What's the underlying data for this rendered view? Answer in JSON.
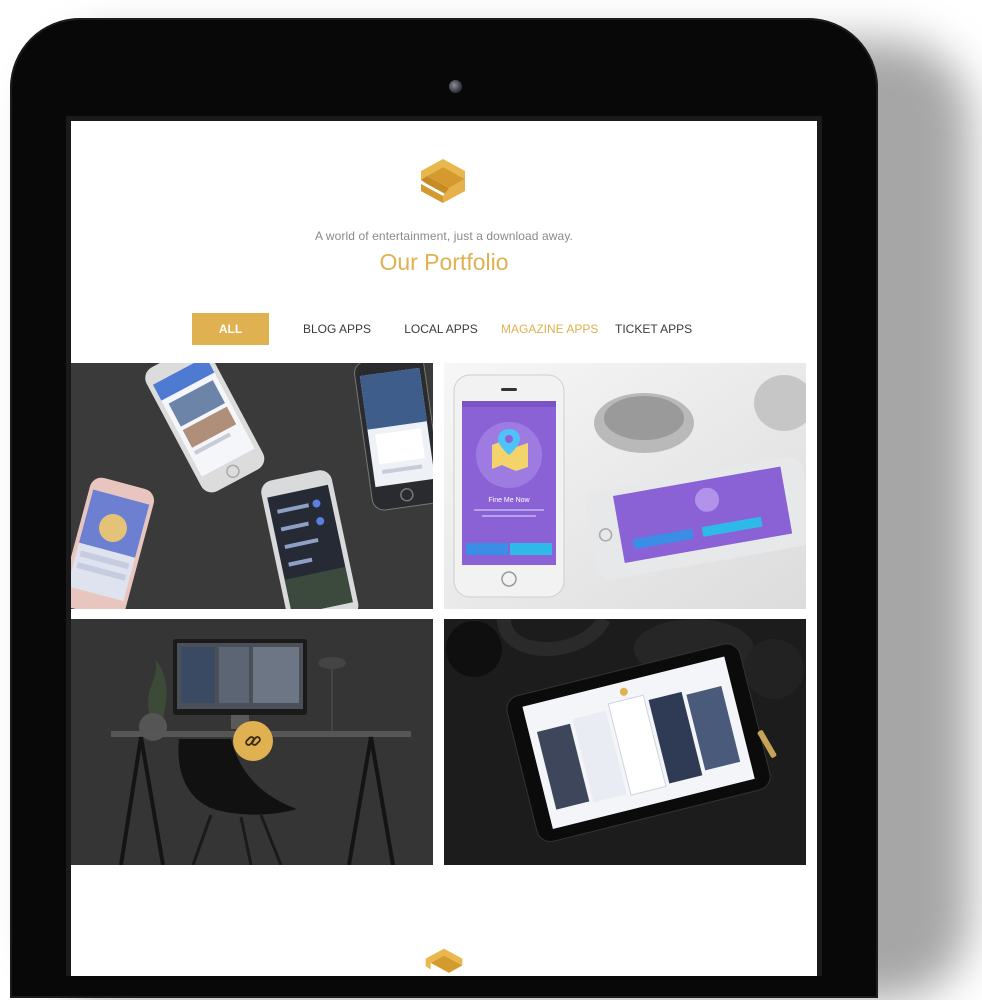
{
  "header": {
    "tagline": "A world of entertainment, just a download away.",
    "title": "Our Portfolio"
  },
  "filters": [
    {
      "label": "ALL",
      "state": "active"
    },
    {
      "label": "BLOG APPS",
      "state": "normal"
    },
    {
      "label": "LOCAL  APPS",
      "state": "normal"
    },
    {
      "label": "MAGAZINE  APPS",
      "state": "highlight"
    },
    {
      "label": "TICKET  APPS",
      "state": "normal"
    }
  ],
  "portfolio": {
    "phone_app_title": "Fine Me Now",
    "phone_app_title_small": "Fine Me Now"
  },
  "icons": {
    "logo": "brand-logo-icon",
    "link": "link-icon"
  },
  "colors": {
    "accent": "#e0b150",
    "purple": "#8a62d6",
    "device": "#080808"
  }
}
